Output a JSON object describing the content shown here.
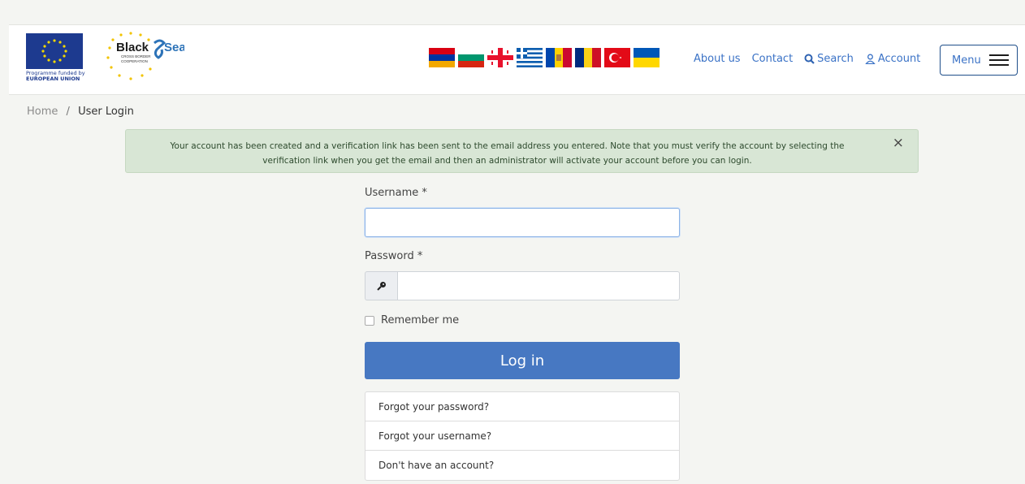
{
  "header": {
    "eu_logo_text": [
      "Programme funded by",
      "EUROPEAN  UNION"
    ],
    "blacksea_logo_text": [
      "Black",
      "Sea",
      "CROSS BORDER",
      "COOPERATION"
    ],
    "flags": [
      "armenia-flag-icon",
      "bulgaria-flag-icon",
      "georgia-flag-icon",
      "greece-flag-icon",
      "moldova-flag-icon",
      "romania-flag-icon",
      "turkey-flag-icon",
      "ukraine-flag-icon"
    ]
  },
  "nav": {
    "about": "About us",
    "contact": "Contact",
    "search": "Search",
    "account": "Account",
    "menu": "Menu"
  },
  "breadcrumb": {
    "home": "Home",
    "separator": "/",
    "current": "User Login"
  },
  "alert": {
    "message": "Your account has been created and a verification link has been sent to the email address you entered. Note that you must verify the account by selecting the verification link when you get the email and then an administrator will activate your account before you can login.",
    "close": "×"
  },
  "form": {
    "username_label": "Username *",
    "username_value": "",
    "password_label": "Password *",
    "password_value": "",
    "remember_label": "Remember me",
    "login_button": "Log in"
  },
  "links": {
    "forgot_password": "Forgot your password?",
    "forgot_username": "Forgot your username?",
    "no_account": "Don't have an account?"
  },
  "colors": {
    "accent": "#4778c2",
    "link": "#3a72c6",
    "alert_bg": "#d8e6d5"
  }
}
